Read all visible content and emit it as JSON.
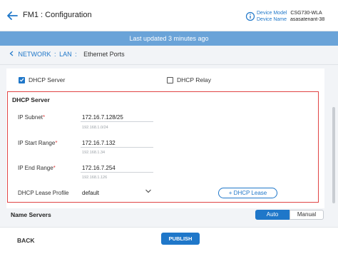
{
  "header": {
    "title": "FM1 : Configuration",
    "device_model_label": "Device Model",
    "device_model_value": "CSG730-WLA",
    "device_name_label": "Device Name",
    "device_name_value": "asasatenant-38"
  },
  "banner": {
    "text": "Last updated 3 minutes ago"
  },
  "breadcrumb": {
    "network": "NETWORK",
    "lan": "LAN",
    "current": "Ethernet Ports"
  },
  "options": {
    "dhcp_server_label": "DHCP Server",
    "dhcp_server_checked": true,
    "dhcp_relay_label": "DHCP Relay",
    "dhcp_relay_checked": false
  },
  "dhcp_server": {
    "title": "DHCP Server",
    "ip_subnet_label": "IP Subnet",
    "ip_subnet_value": "172.16.7.128/25",
    "ip_subnet_hint": "192.168.1.0/24",
    "ip_start_label": "IP Start Range",
    "ip_start_value": "172.16.7.132",
    "ip_start_hint": "192.168.1.34",
    "ip_end_label": "IP End Range",
    "ip_end_value": "172.16.7.254",
    "ip_end_hint": "192.168.1.126",
    "lease_profile_label": "DHCP Lease Profile",
    "lease_profile_value": "default",
    "dhcp_lease_button": "+ DHCP Lease"
  },
  "name_servers": {
    "label": "Name Servers",
    "auto_label": "Auto",
    "manual_label": "Manual",
    "selected": "Auto"
  },
  "footer": {
    "back_label": "BACK",
    "publish_label": "PUBLISH"
  },
  "colors": {
    "accent": "#1f77c9",
    "banner": "#6aa3d8",
    "error_border": "#e04545"
  },
  "icons": {
    "back": "back-arrow-icon",
    "info": "info-icon",
    "breadcrumb": "chevron-left-icon",
    "select": "chevron-down-icon",
    "check": "checkmark-icon"
  }
}
